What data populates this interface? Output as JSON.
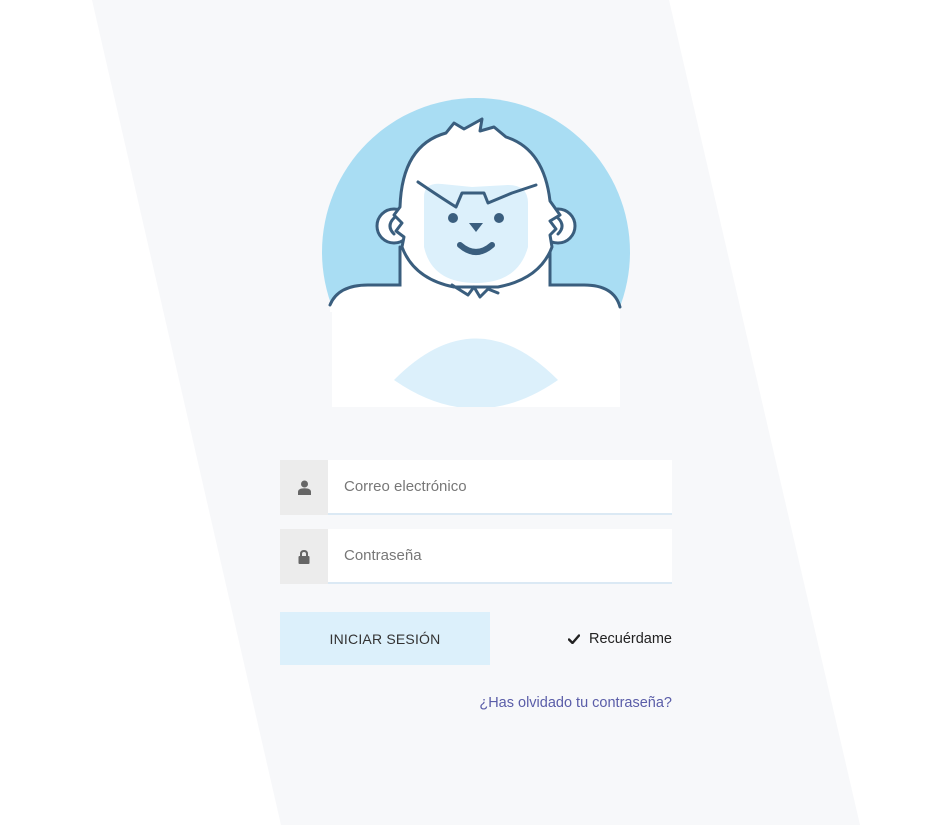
{
  "form": {
    "email": {
      "placeholder": "Correo electrónico",
      "value": "",
      "icon": "user-icon"
    },
    "password": {
      "placeholder": "Contraseña",
      "value": "",
      "icon": "lock-icon"
    },
    "submit_label": "INICIAR SESIÓN",
    "remember": {
      "label": "Recuérdame",
      "checked": true,
      "icon": "checkmark-icon"
    },
    "forgot_label": "¿Has olvidado tu contraseña?"
  },
  "mascot": {
    "name": "yeti"
  },
  "colors": {
    "background": "#ffffff",
    "band": "#f7f8fa",
    "mascot_circle": "#a9ddf3",
    "mascot_outline": "#3a5e7e",
    "mascot_face": "#dcf0fb",
    "addon": "#ececec",
    "button": "#dcf0fb",
    "link": "#5a5da8"
  }
}
